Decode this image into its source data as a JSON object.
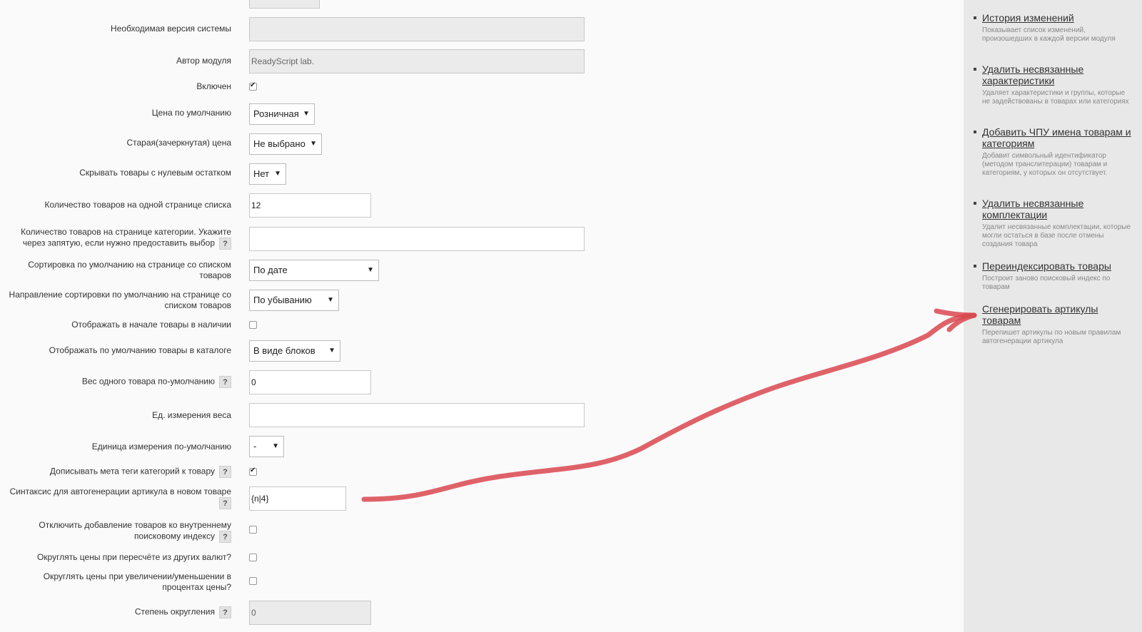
{
  "form": {
    "system_version_label": "Необходимая версия системы",
    "system_version_value": "",
    "author_label": "Автор модуля",
    "author_value": "ReadyScript lab.",
    "enabled_label": "Включен",
    "enabled_checked": true,
    "default_price_label": "Цена по умолчанию",
    "default_price_value": "Розничная",
    "old_price_label": "Старая(зачеркнутая) цена",
    "old_price_value": "Не выбрано",
    "hide_zero_label": "Скрывать товары с нулевым остатком",
    "hide_zero_value": "Нет",
    "per_page_label": "Количество товаров на одной странице списка",
    "per_page_value": "12",
    "per_page_category_label": "Количество товаров на странице категории. Укажите через запятую, если нужно предоставить выбор",
    "per_page_category_value": "",
    "default_sort_label": "Сортировка по умолчанию на странице со списком товаров",
    "default_sort_value": "По дате",
    "sort_direction_label": "Направление сортировки по умолчанию на странице со списком товаров",
    "sort_direction_value": "По убыванию",
    "in_stock_first_label": "Отображать в начале товары в наличии",
    "in_stock_first_checked": false,
    "catalog_view_label": "Отображать по умолчанию товары в каталоге",
    "catalog_view_value": "В виде блоков",
    "default_weight_label": "Вес одного товара по-умолчанию",
    "default_weight_value": "0",
    "weight_unit_label": "Ед. измерения веса",
    "weight_unit_value": "",
    "default_unit_label": "Единица измерения по-умолчанию",
    "default_unit_value": "-",
    "meta_tags_label": "Дописывать мета теги категорий к товару",
    "meta_tags_checked": true,
    "article_syntax_label": "Синтаксис для автогенерации артикула в новом товаре",
    "article_syntax_value": "{n|4}",
    "disable_index_label": "Отключить добавление товаров ко внутреннему поисковому индексу",
    "disable_index_checked": false,
    "round_currency_label": "Округлять цены при пересчёте из других валют?",
    "round_currency_checked": false,
    "round_percent_label": "Округлять цены при увеличении/уменьшении в процентах цены?",
    "round_percent_checked": false,
    "round_degree_label": "Степень округления",
    "round_degree_value": "0",
    "help_glyph": "?"
  },
  "sidebar": {
    "items": [
      {
        "label": "История изменений",
        "desc": "Показывает список изменений, произошедших в каждой версии модуля"
      },
      {
        "label": "Удалить несвязанные характеристики",
        "desc": "Удаляет характеристики и группы, которые не задействованы в товарах или категориях"
      },
      {
        "label": "Добавить ЧПУ имена товарам и категориям",
        "desc": "Добавит символьный идентификатор (методом транслитерации) товарам и категориям, у которых он отсутствует."
      },
      {
        "label": "Удалить несвязанные комплектации",
        "desc": "Удалит несвязанные комплектации, которые могли остаться в базе после отмены создания товара"
      },
      {
        "label": "Переиндексировать товары",
        "desc": "Построит заново поисковый индекс по товарам"
      },
      {
        "label": "Сгенерировать артикулы товарам",
        "desc": "Перепишет артикулы по новым правилам автогенерации артикула"
      }
    ]
  },
  "annotation": {
    "color": "#d9474f"
  }
}
